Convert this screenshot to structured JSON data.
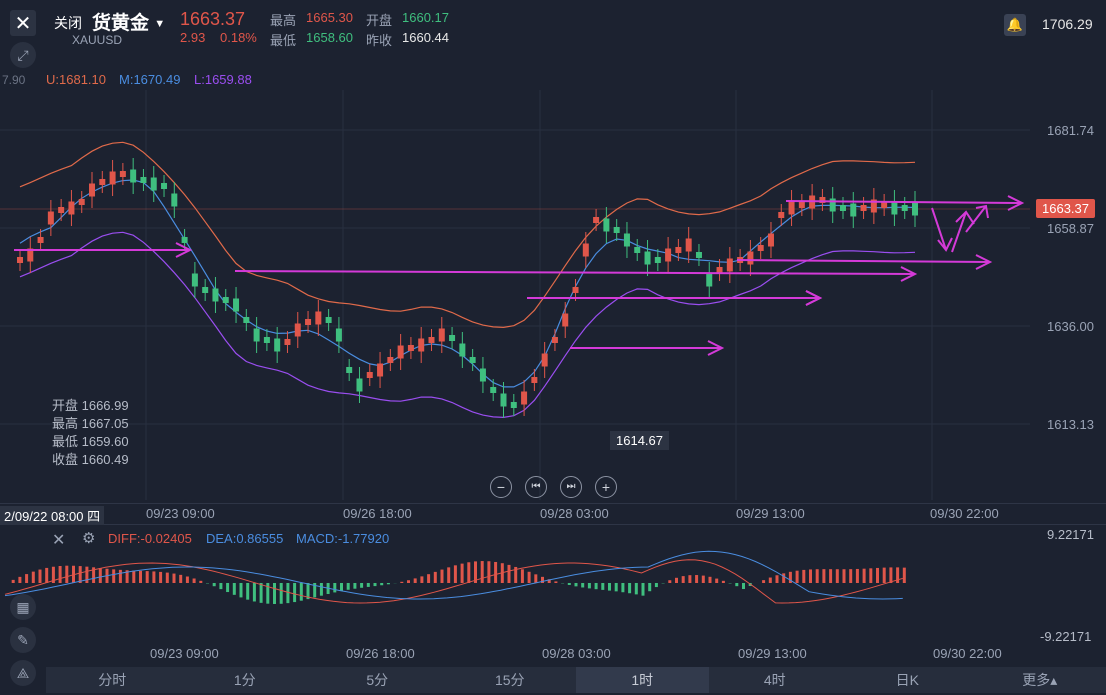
{
  "header": {
    "close_label": "关闭",
    "title": "货黄金",
    "symbol": "XAUUSD",
    "price": "1663.37",
    "change": "2.93",
    "change_pct": "0.18%",
    "high_label": "最高",
    "high_value": "1665.30",
    "open_label": "开盘",
    "open_value": "1660.17",
    "low_label": "最低",
    "low_value": "1658.60",
    "prev_close_label": "昨收",
    "prev_close_value": "1660.44",
    "right_value": "1706.29"
  },
  "indicator": {
    "left_clip": "7.90",
    "upper": "U:1681.10",
    "middle": "M:1670.49",
    "lower": "L:1659.88"
  },
  "price_axis": [
    "1681.74",
    "1658.87",
    "1636.00",
    "1613.13"
  ],
  "current_price_tag": "1663.37",
  "low_marker": "1614.67",
  "ohlc_box": {
    "open": "开盘 1666.99",
    "high": "最高 1667.05",
    "low": "最低 1659.60",
    "close": "收盘 1660.49"
  },
  "time_axis": {
    "cursor_label": "2/09/22 08:00 四",
    "labels": [
      "09/23 09:00",
      "09/26 18:00",
      "09/28 03:00",
      "09/29 13:00",
      "09/30 22:00"
    ]
  },
  "macd": {
    "diff": "DIFF:-0.02405",
    "dea": "DEA:0.86555",
    "macd": "MACD:-1.77920",
    "top": "9.22171",
    "bottom": "-9.22171"
  },
  "tabs": [
    "分时",
    "1分",
    "5分",
    "15分",
    "1时",
    "4时",
    "日K",
    "更多▴"
  ],
  "active_tab": "1时",
  "colors": {
    "up": "#e0564a",
    "down": "#3fbf7f",
    "annotation": "#d43ad8",
    "boll_mid": "#4a8de0",
    "boll_low": "#9a4ef0",
    "boll_up": "#e06a4a"
  }
}
